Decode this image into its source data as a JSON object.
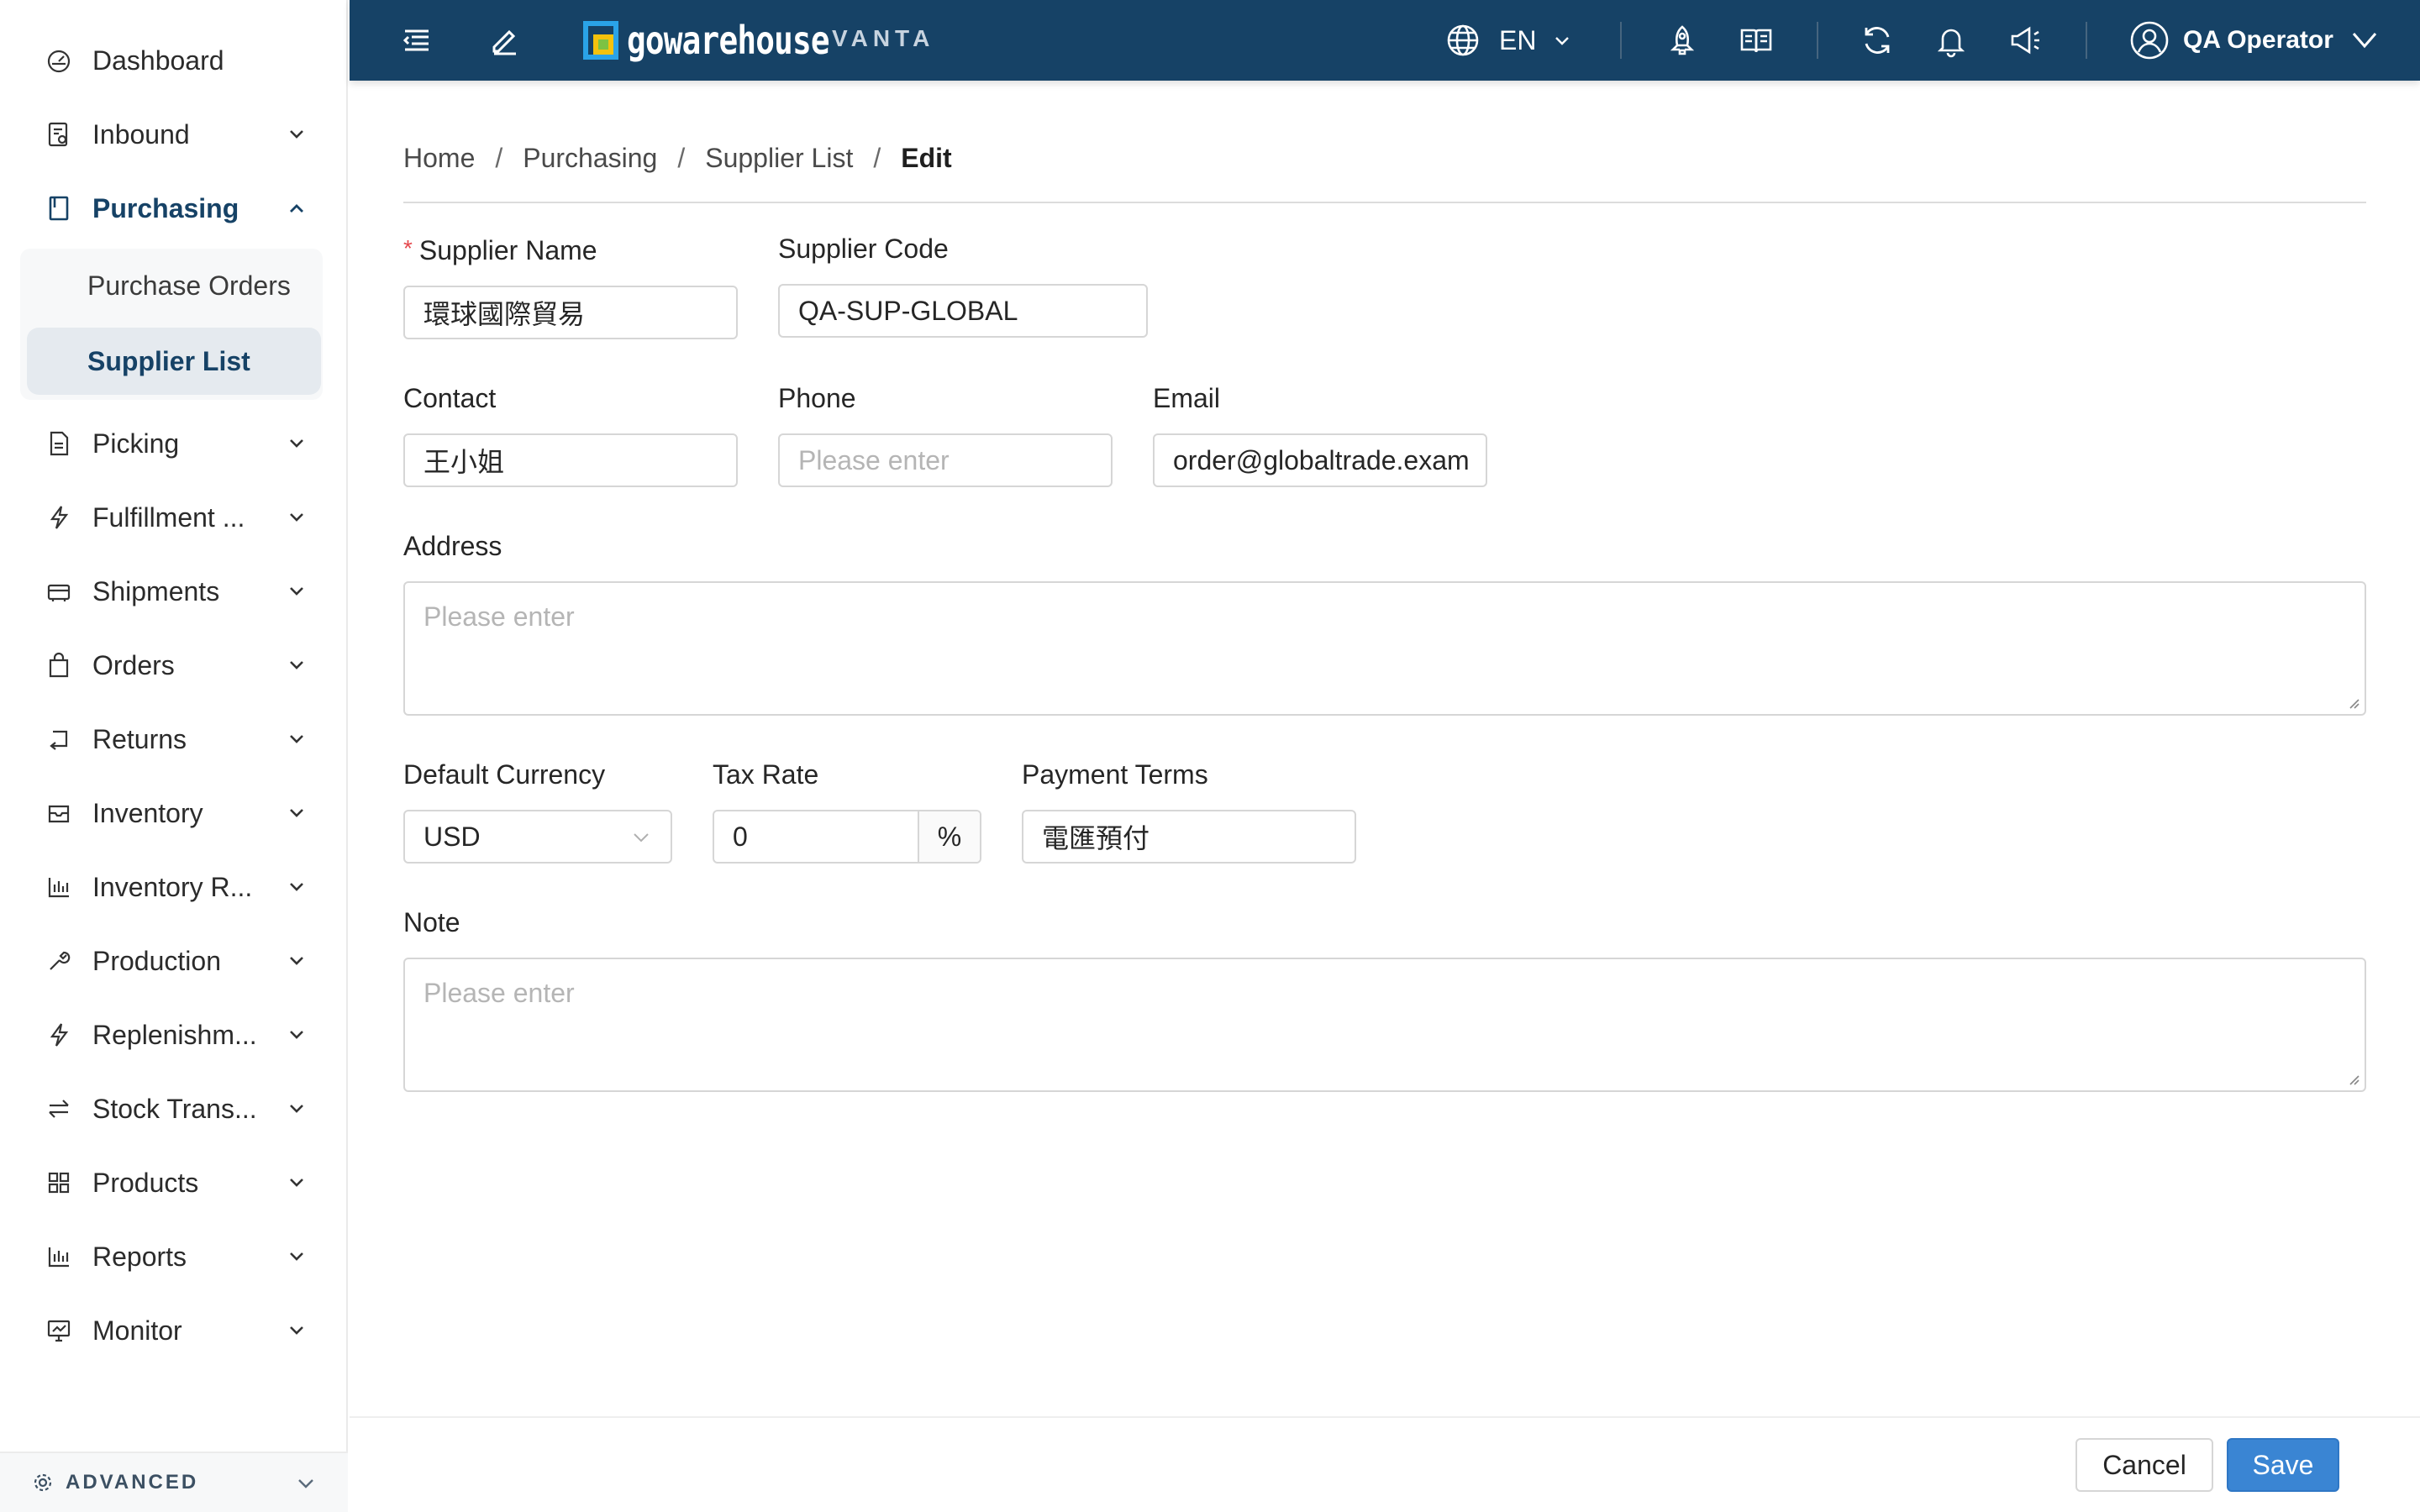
{
  "sidebar": {
    "items": [
      {
        "label": "Dashboard",
        "icon": "dashboard-icon"
      },
      {
        "label": "Inbound",
        "icon": "inbound-icon"
      },
      {
        "label": "Purchasing",
        "icon": "purchasing-icon"
      },
      {
        "label": "Picking",
        "icon": "picking-icon"
      },
      {
        "label": "Fulfillment ...",
        "icon": "fulfillment-icon"
      },
      {
        "label": "Shipments",
        "icon": "shipments-icon"
      },
      {
        "label": "Orders",
        "icon": "orders-icon"
      },
      {
        "label": "Returns",
        "icon": "returns-icon"
      },
      {
        "label": "Inventory",
        "icon": "inventory-icon"
      },
      {
        "label": "Inventory R...",
        "icon": "inventory-reports-icon"
      },
      {
        "label": "Production",
        "icon": "production-icon"
      },
      {
        "label": "Replenishm...",
        "icon": "replenishment-icon"
      },
      {
        "label": "Stock Trans...",
        "icon": "stock-transfer-icon"
      },
      {
        "label": "Products",
        "icon": "products-icon"
      },
      {
        "label": "Reports",
        "icon": "reports-icon"
      },
      {
        "label": "Monitor",
        "icon": "monitor-icon"
      }
    ],
    "submenu": [
      {
        "label": "Purchase Orders"
      },
      {
        "label": "Supplier List"
      }
    ],
    "advanced_label": "ADVANCED"
  },
  "header": {
    "logo_text": "gowarehouse",
    "logo_sub": "VANTA",
    "language": "EN",
    "user_name": "QA Operator"
  },
  "breadcrumb": [
    "Home",
    "Purchasing",
    "Supplier List",
    "Edit"
  ],
  "form": {
    "supplier_name": {
      "label": "Supplier Name",
      "required_mark": "*",
      "value": "環球國際貿易"
    },
    "supplier_code": {
      "label": "Supplier Code",
      "value": "QA-SUP-GLOBAL"
    },
    "contact": {
      "label": "Contact",
      "value": "王小姐"
    },
    "phone": {
      "label": "Phone",
      "placeholder": "Please enter"
    },
    "email": {
      "label": "Email",
      "value": "order@globaltrade.exam"
    },
    "address": {
      "label": "Address",
      "placeholder": "Please enter"
    },
    "default_currency": {
      "label": "Default Currency",
      "value": "USD"
    },
    "tax_rate": {
      "label": "Tax Rate",
      "value": "0",
      "suffix": "%"
    },
    "payment_terms": {
      "label": "Payment Terms",
      "value": "電匯預付"
    },
    "note": {
      "label": "Note",
      "placeholder": "Please enter"
    }
  },
  "footer": {
    "cancel_label": "Cancel",
    "save_label": "Save"
  },
  "colors": {
    "header_bg": "#164266",
    "active_text": "#164266",
    "primary_button": "#3a85d3",
    "required": "#e5484d"
  }
}
